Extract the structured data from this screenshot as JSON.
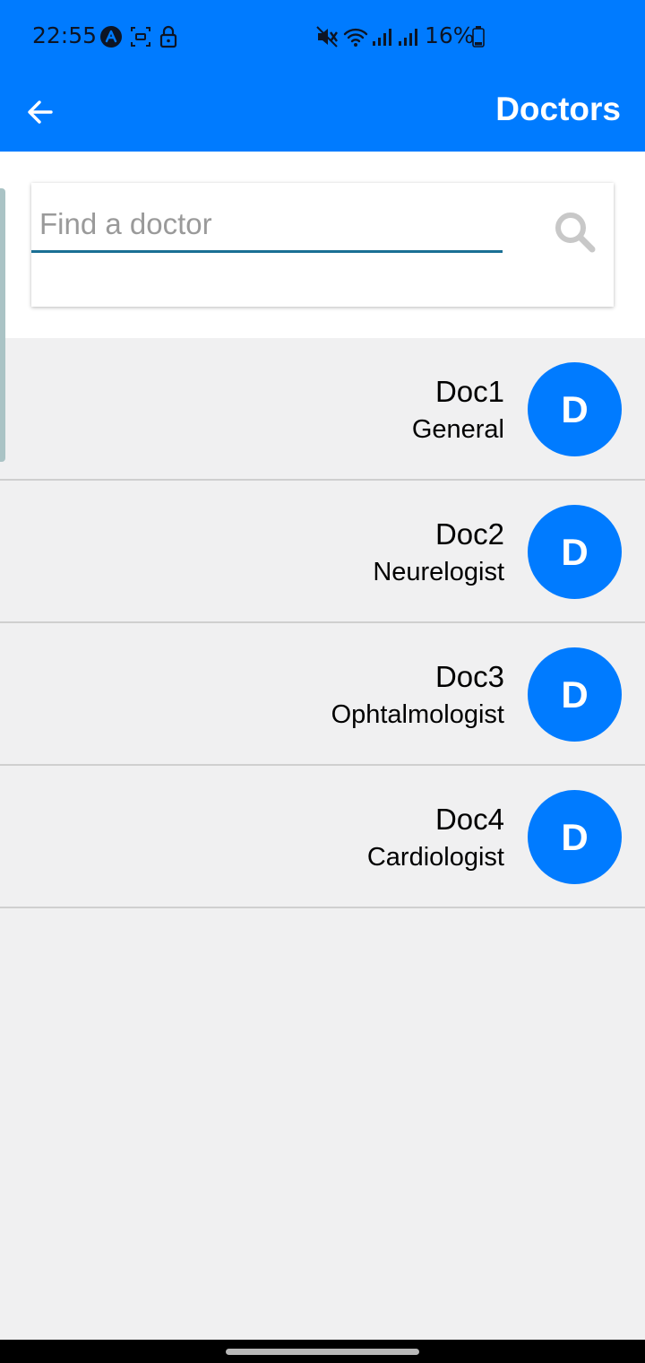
{
  "status_bar": {
    "time": "22:55",
    "battery": "16%",
    "icons": [
      "app-notification-icon",
      "screenshot-icon",
      "lock-icon",
      "mute-icon",
      "wifi-icon",
      "signal-icon",
      "signal-icon",
      "battery-icon"
    ]
  },
  "app_bar": {
    "title": "Doctors",
    "back_icon": "arrow-left-icon"
  },
  "search": {
    "placeholder": "Find a doctor",
    "value": "",
    "icon": "search-icon"
  },
  "doctors": [
    {
      "name": "Doc1",
      "specialty": "General",
      "initial": "D"
    },
    {
      "name": "Doc2",
      "specialty": "Neurelogist",
      "initial": "D"
    },
    {
      "name": "Doc3",
      "specialty": "Ophtalmologist",
      "initial": "D"
    },
    {
      "name": "Doc4",
      "specialty": "Cardiologist",
      "initial": "D"
    }
  ],
  "colors": {
    "primary": "#007bff",
    "background": "#f0f0f1",
    "input_underline": "#1a6f94",
    "placeholder": "#9a9a9a"
  }
}
